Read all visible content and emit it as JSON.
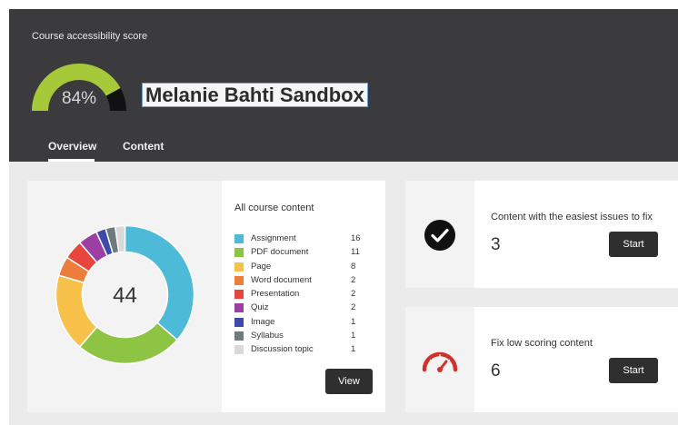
{
  "header": {
    "score_label": "Course accessibility score",
    "score_value": "84%",
    "score_fraction": 0.84,
    "course_title": "Melanie Bahti Sandbox",
    "tabs": [
      {
        "label": "Overview",
        "active": true
      },
      {
        "label": "Content",
        "active": false
      }
    ]
  },
  "content_card": {
    "title": "All course content",
    "total": "44",
    "view_label": "View",
    "items": [
      {
        "name": "Assignment",
        "count": "16",
        "color": "#4dbad8"
      },
      {
        "name": "PDF document",
        "count": "11",
        "color": "#8dc443"
      },
      {
        "name": "Page",
        "count": "8",
        "color": "#f7c14a"
      },
      {
        "name": "Word document",
        "count": "2",
        "color": "#ee7c3b"
      },
      {
        "name": "Presentation",
        "count": "2",
        "color": "#e8453c"
      },
      {
        "name": "Quiz",
        "count": "2",
        "color": "#9c3fa3"
      },
      {
        "name": "Image",
        "count": "1",
        "color": "#3d4aa8"
      },
      {
        "name": "Syllabus",
        "count": "1",
        "color": "#6f7a7c"
      },
      {
        "name": "Discussion topic",
        "count": "1",
        "color": "#d9d9d9"
      }
    ]
  },
  "easy_card": {
    "title": "Content with the easiest issues to fix",
    "count": "3",
    "start_label": "Start",
    "icon": "checkmark-circle-icon"
  },
  "low_card": {
    "title": "Fix low scoring content",
    "count": "6",
    "start_label": "Start",
    "icon": "speedometer-icon"
  },
  "colors": {
    "header_bg": "#3b3b3d",
    "gauge_good": "#a6c93a",
    "gauge_bad": "#111111",
    "speed_icon": "#d0312d"
  }
}
